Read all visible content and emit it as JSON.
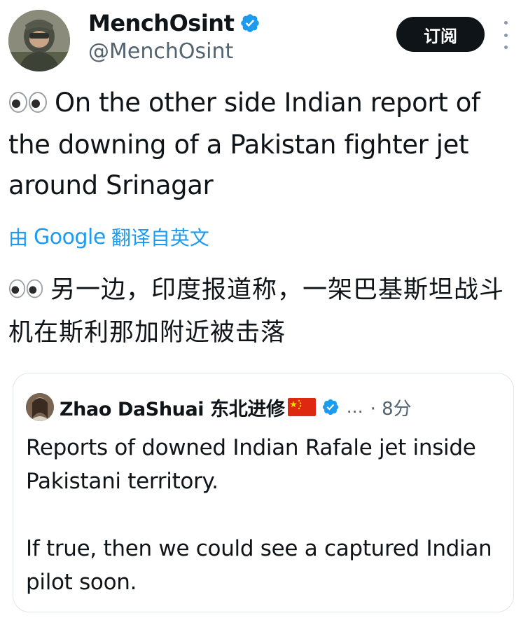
{
  "author": {
    "display_name": "MenchOsint",
    "handle": "@MenchOsint",
    "verified_icon": "verified-badge-icon",
    "avatar_icon": "pilot-avatar"
  },
  "actions": {
    "subscribe_label": "订阅",
    "more_icon": "more-vertical-icon"
  },
  "post": {
    "emoji": "👀",
    "text": "On the other side Indian report of the downing of a Pakistan fighter jet around Srinagar"
  },
  "translation": {
    "prefix": "由",
    "provider": "Google",
    "suffix": "翻译自英文",
    "text": "另一边，印度报道称，一架巴基斯坦战斗机在斯利那加附近被击落"
  },
  "quoted_post": {
    "display_name": "Zhao DaShuai 东北进修",
    "flag_icon": "china-flag-icon",
    "verified_icon": "verified-badge-icon",
    "ellipsis": "…",
    "time": "· 8分",
    "paragraph_1": "Reports of downed Indian Rafale jet inside Pakistani territory.",
    "paragraph_2": "If true, then we could see a captured Indian pilot soon."
  },
  "colors": {
    "text": "#0f1419",
    "secondary": "#536471",
    "link": "#1d9bf0",
    "button_bg": "#0f1419",
    "border": "#e1e6ea"
  }
}
